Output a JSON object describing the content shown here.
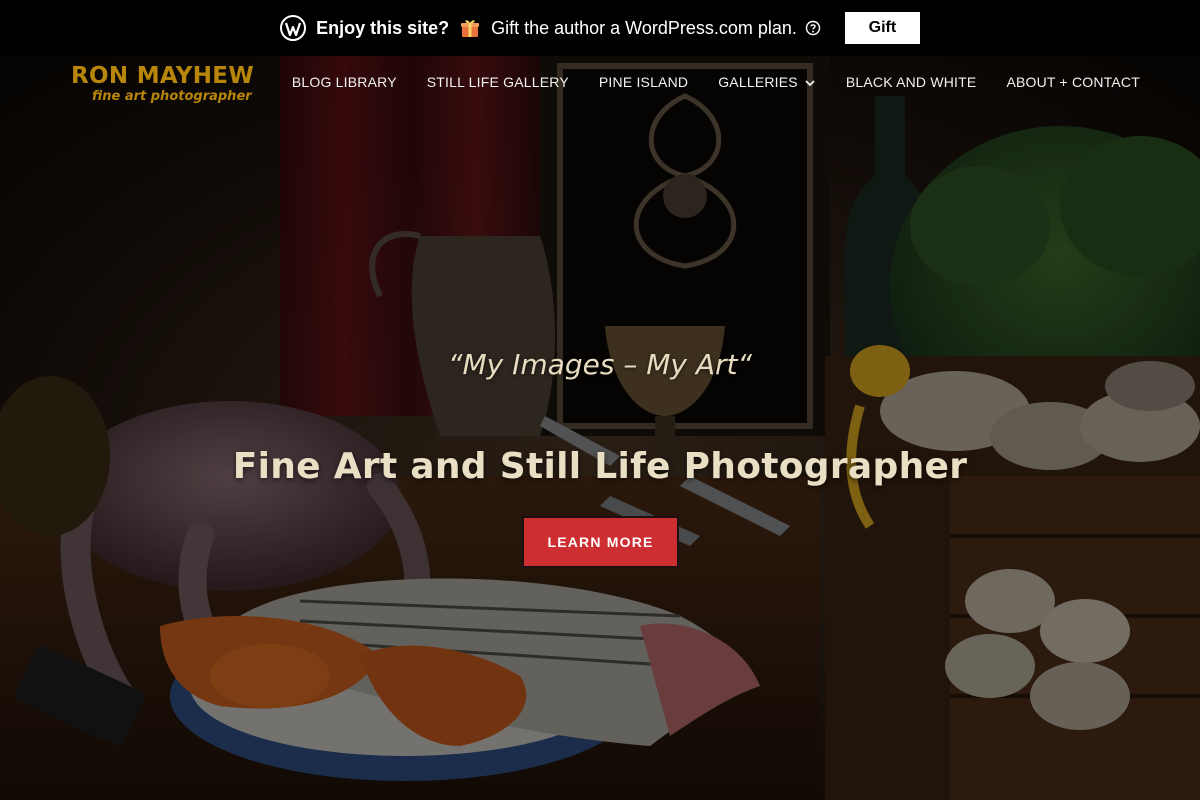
{
  "promo": {
    "strong": "Enjoy this site?",
    "message": "Gift the author a WordPress.com plan.",
    "button": "Gift",
    "icons": [
      "wordpress-logo-icon",
      "gift-icon",
      "help-icon"
    ]
  },
  "site": {
    "title": "RON MAYHEW",
    "tagline": "fine art photographer",
    "brand_color": "#b8860b"
  },
  "nav": {
    "items": [
      {
        "label": "BLOG LIBRARY"
      },
      {
        "label": "STILL LIFE GALLERY"
      },
      {
        "label": "PINE ISLAND"
      },
      {
        "label": "GALLERIES",
        "has_dropdown": true
      },
      {
        "label": "BLACK AND WHITE"
      },
      {
        "label": "ABOUT + CONTACT"
      }
    ]
  },
  "hero": {
    "tagline": "“My Images – My Art“",
    "headline": "Fine Art and Still Life Photographer",
    "cta": "LEARN MORE",
    "cta_color": "#cc2e32",
    "image": "still-life-photo"
  }
}
